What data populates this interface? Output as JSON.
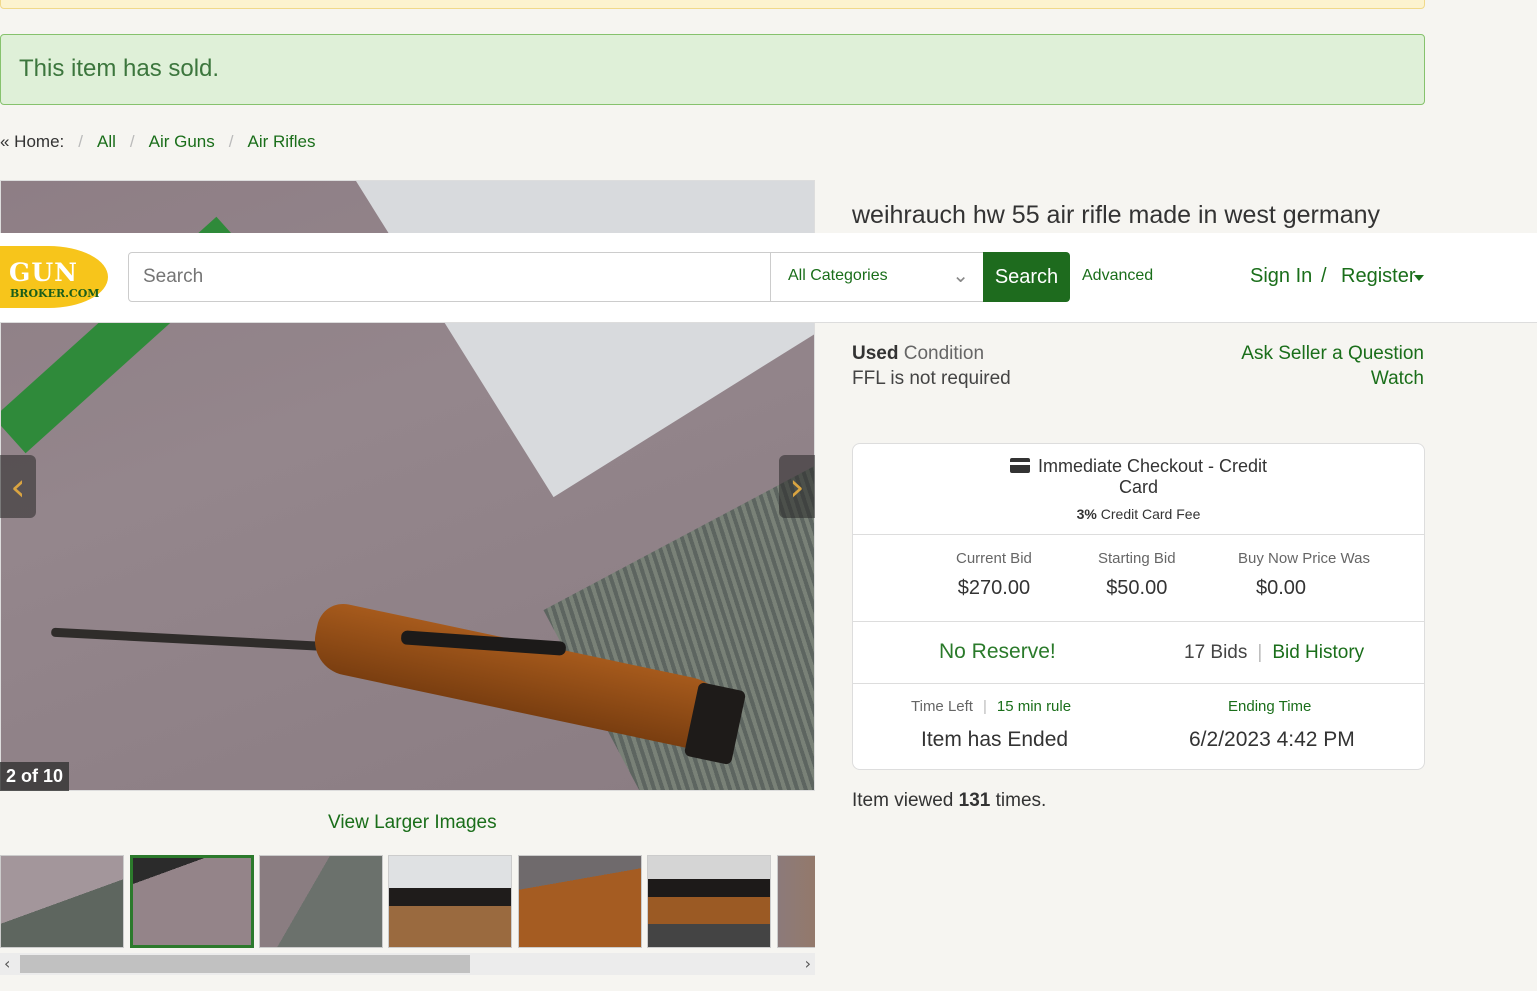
{
  "alert": {
    "sold_text": "This item has sold."
  },
  "breadcrumb": {
    "home": "« Home:",
    "items": [
      "All",
      "Air Guns",
      "Air Rifles"
    ]
  },
  "gallery": {
    "counter": "2 of 10",
    "view_larger": "View Larger Images",
    "prev_icon": "chevron-left-icon",
    "next_icon": "chevron-right-icon"
  },
  "header": {
    "logo_line1": "GUN",
    "logo_line2": "BROKER.COM",
    "search_placeholder": "Search",
    "category": "All Categories",
    "search_button": "Search",
    "advanced": "Advanced",
    "sign_in": "Sign In",
    "divider": "/",
    "register": "Register"
  },
  "listing": {
    "title": "weihrauch hw 55 air rifle made in west germany",
    "condition_value": "Used",
    "condition_label": "Condition",
    "ffl": "FFL is not required",
    "ask_seller": "Ask Seller a Question",
    "watch": "Watch",
    "viewed_prefix": "Item viewed",
    "viewed_count": "131",
    "viewed_suffix": "times."
  },
  "card": {
    "checkout_line1": "Immediate Checkout - Credit",
    "checkout_line2": "Card",
    "fee_pct": "3%",
    "fee_label": "Credit Card Fee",
    "current_bid_label": "Current Bid",
    "current_bid": "$270.00",
    "starting_bid_label": "Starting Bid",
    "starting_bid": "$50.00",
    "buy_now_label": "Buy Now Price Was",
    "buy_now": "$0.00",
    "no_reserve": "No Reserve!",
    "bids": "17 Bids",
    "bid_history": "Bid History",
    "time_left_label": "Time Left",
    "rule": "15 min rule",
    "ending_label": "Ending Time",
    "status": "Item has Ended",
    "ending_time": "6/2/2023 4:42 PM"
  },
  "colors": {
    "brand_green": "#1e6b1e",
    "logo_yellow": "#f7c51b",
    "sold_bg": "#dff0d8"
  }
}
